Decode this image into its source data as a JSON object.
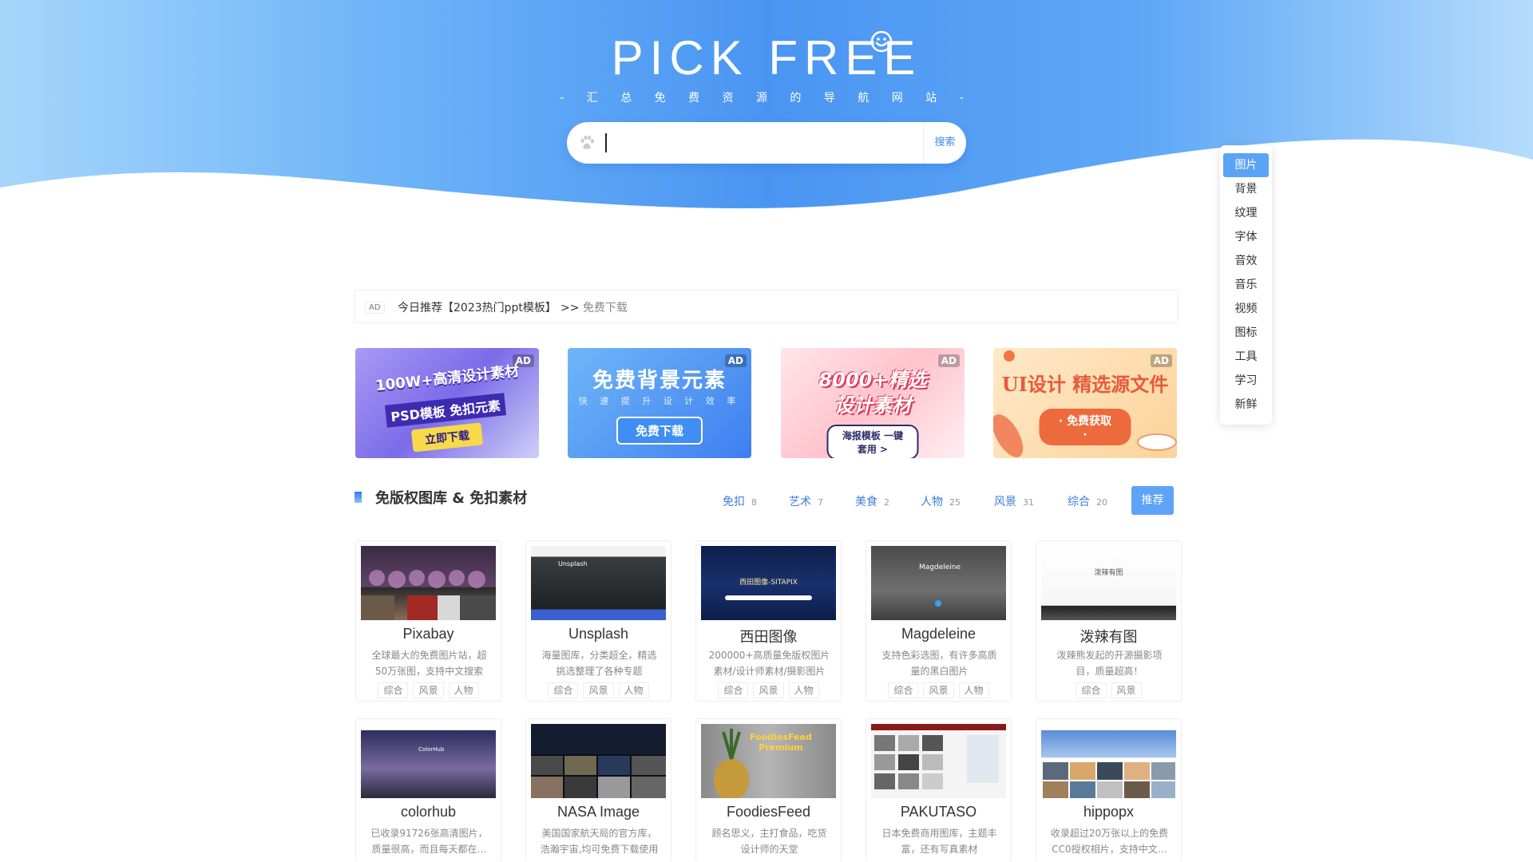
{
  "brand": {
    "title": "PICK FREE",
    "subtitle": "- 汇 总 免 费 资 源 的 导 航 网 站 -"
  },
  "search": {
    "placeholder": "",
    "button_label": "搜索"
  },
  "side_nav": {
    "items": [
      {
        "label": "图片",
        "active": true
      },
      {
        "label": "背景"
      },
      {
        "label": "纹理"
      },
      {
        "label": "字体"
      },
      {
        "label": "音效"
      },
      {
        "label": "音乐"
      },
      {
        "label": "视频"
      },
      {
        "label": "图标"
      },
      {
        "label": "工具"
      },
      {
        "label": "学习"
      },
      {
        "label": "新鲜"
      }
    ]
  },
  "notice": {
    "ad_tag": "AD",
    "text": "今日推荐【2023热门ppt模板】",
    "arrow": ">>",
    "link": "免费下载"
  },
  "banners": [
    {
      "ad": "AD",
      "line1": "100W+高清设计素材",
      "line2": "PSD模板 免扣元素",
      "button": "立即下载"
    },
    {
      "ad": "AD",
      "line1": "免费背景元素",
      "line2": "快 速 提 升 设 计 效 率",
      "button": "免费下载"
    },
    {
      "ad": "AD",
      "line1": "8000+精选",
      "line2": "设计素材",
      "button": "海报模板 一键套用 >"
    },
    {
      "ad": "AD",
      "line1": "UI设计 精选源文件",
      "button": "· 免费获取 ·"
    }
  ],
  "section": {
    "title": "免版权图库 & 免扣素材",
    "tabs": [
      {
        "label": "免扣",
        "count": "8"
      },
      {
        "label": "艺术",
        "count": "7"
      },
      {
        "label": "美食",
        "count": "2"
      },
      {
        "label": "人物",
        "count": "25"
      },
      {
        "label": "风景",
        "count": "31"
      },
      {
        "label": "综合",
        "count": "20"
      }
    ],
    "active_tab": "推荐"
  },
  "cards": [
    {
      "name": "Pixabay",
      "desc": "全球最大的免费图片站，超50万张图，支持中文搜索",
      "tags": [
        "综合",
        "风景",
        "人物"
      ]
    },
    {
      "name": "Unsplash",
      "desc": "海量图库，分类超全，精选挑选整理了各种专题",
      "tags": [
        "综合",
        "风景",
        "人物"
      ]
    },
    {
      "name": "西田图像",
      "desc": "200000+高质量免版权图片素材/设计师素材/摄影图片",
      "tags": [
        "综合",
        "风景",
        "人物"
      ]
    },
    {
      "name": "Magdeleine",
      "desc": "支持色彩选图，有许多高质量的黑白图片",
      "tags": [
        "综合",
        "风景",
        "人物"
      ]
    },
    {
      "name": "泼辣有图",
      "desc": "泼辣熊发起的开源摄影项目，质量超高！",
      "tags": [
        "综合",
        "风景"
      ]
    },
    {
      "name": "colorhub",
      "desc": "已收录91726张高清图片，质量很高，而且每天都在…",
      "tags": []
    },
    {
      "name": "NASA Image",
      "desc": "美国国家航天局的官方库，浩瀚宇宙,均可免费下载使用",
      "tags": []
    },
    {
      "name": "FoodiesFeed",
      "desc": "顾名思义，主打食品，吃货设计师的天堂",
      "tags": []
    },
    {
      "name": "PAKUTASO",
      "desc": "日本免费商用图库，主题丰富，还有写真素材",
      "tags": []
    },
    {
      "name": "hippopx",
      "desc": "收录超过20万张以上的免费CC0授权相片，支持中文…",
      "tags": []
    }
  ],
  "card_shot_text": {
    "unsplash": "Unsplash",
    "sitapix": "西田图像-SITAPIX",
    "magdeleine": "Magdeleine",
    "pola": "泼辣有图",
    "colorhub": "ColorHub",
    "foodies": "FoodiesFeed Premium"
  },
  "colors": {
    "hero_blue": "#4a90f0",
    "accent": "#5ea3f7",
    "link_blue": "#3c7ddd"
  }
}
